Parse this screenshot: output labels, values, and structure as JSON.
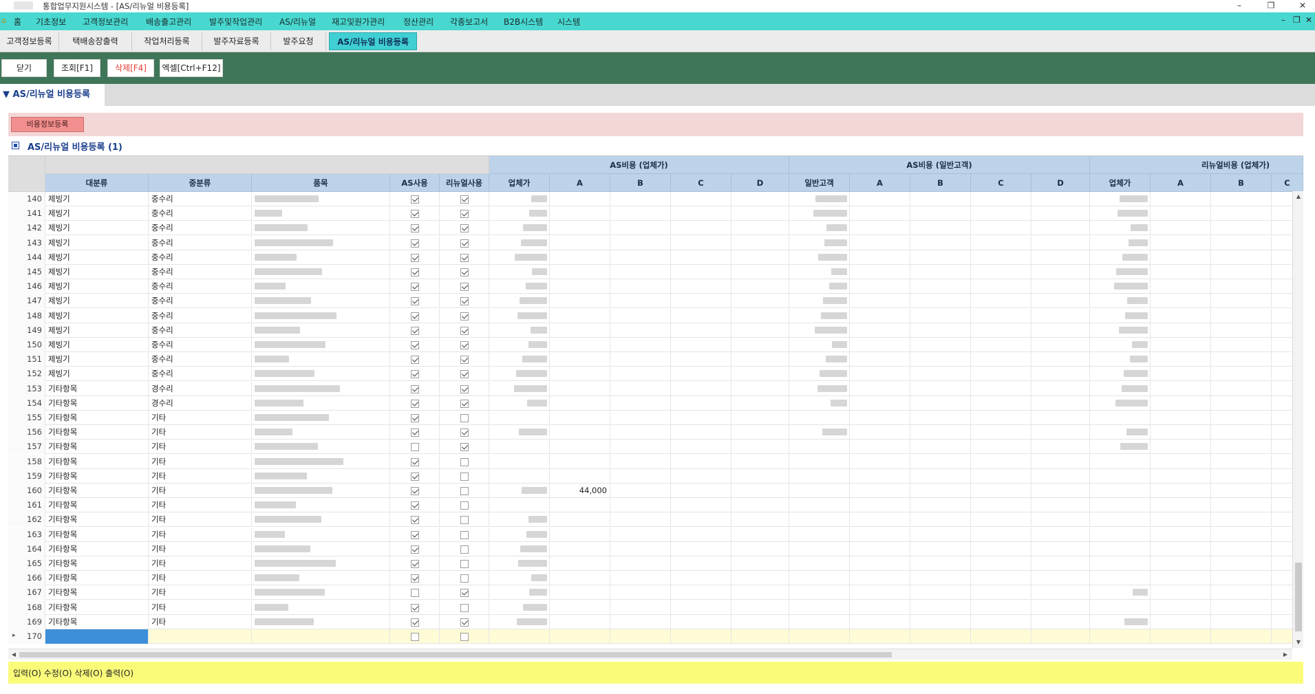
{
  "window": {
    "title": "통합업무지원시스템 - [AS/리뉴얼 비용등록]",
    "controls": [
      "–",
      "❐",
      "✕"
    ]
  },
  "menu": {
    "items": [
      "홈",
      "기초정보",
      "고객정보관리",
      "배송출고관리",
      "발주및작업관리",
      "AS/리뉴얼",
      "재고및원가관리",
      "정산관리",
      "각종보고서",
      "B2B시스템",
      "시스템"
    ],
    "right_controls": [
      "–",
      "❐",
      "✕"
    ]
  },
  "tabs": {
    "items": [
      "고객정보등록",
      "택배송장출력",
      "작업처리등록",
      "발주자료등록",
      "발주요청",
      "AS/리뉴얼 비용등록"
    ],
    "active_index": 5
  },
  "toolbar": {
    "close": "닫기",
    "search": "조회[F1]",
    "delete": "삭제[F4]",
    "excel": "엑셀[Ctrl+F12]"
  },
  "section": {
    "tab_label": "▼ AS/리뉴얼 비용등록"
  },
  "panel": {
    "button": "비용정보등록"
  },
  "grid": {
    "title": "AS/리뉴얼 비용등록 (1)",
    "group_headers": [
      "AS비용 (업체가)",
      "AS비용 (일반고객)",
      "리뉴얼비용 (업체가)"
    ],
    "columns": [
      "대분류",
      "중분류",
      "품목",
      "AS사용",
      "리뉴얼사용",
      "업체가",
      "A",
      "B",
      "C",
      "D",
      "일반고객",
      "A",
      "B",
      "C",
      "D",
      "업체가",
      "A",
      "B",
      "C"
    ],
    "rows": [
      {
        "no": "140",
        "major": "제빙기",
        "minor": "중수리",
        "as": true,
        "renew": true
      },
      {
        "no": "141",
        "major": "제빙기",
        "minor": "중수리",
        "as": true,
        "renew": true
      },
      {
        "no": "142",
        "major": "제빙기",
        "minor": "중수리",
        "as": true,
        "renew": true
      },
      {
        "no": "143",
        "major": "제빙기",
        "minor": "중수리",
        "as": true,
        "renew": true
      },
      {
        "no": "144",
        "major": "제빙기",
        "minor": "중수리",
        "as": true,
        "renew": true
      },
      {
        "no": "145",
        "major": "제빙기",
        "minor": "중수리",
        "as": true,
        "renew": true
      },
      {
        "no": "146",
        "major": "제빙기",
        "minor": "중수리",
        "as": true,
        "renew": true
      },
      {
        "no": "147",
        "major": "제빙기",
        "minor": "중수리",
        "as": true,
        "renew": true
      },
      {
        "no": "148",
        "major": "제빙기",
        "minor": "중수리",
        "as": true,
        "renew": true
      },
      {
        "no": "149",
        "major": "제빙기",
        "minor": "중수리",
        "as": true,
        "renew": true
      },
      {
        "no": "150",
        "major": "제빙기",
        "minor": "중수리",
        "as": true,
        "renew": true
      },
      {
        "no": "151",
        "major": "제빙기",
        "minor": "중수리",
        "as": true,
        "renew": true
      },
      {
        "no": "152",
        "major": "제빙기",
        "minor": "중수리",
        "as": true,
        "renew": true
      },
      {
        "no": "153",
        "major": "기타항목",
        "minor": "경수리",
        "as": true,
        "renew": true
      },
      {
        "no": "154",
        "major": "기타항목",
        "minor": "경수리",
        "as": true,
        "renew": true
      },
      {
        "no": "155",
        "major": "기타항목",
        "minor": "기타",
        "as": true,
        "renew": false
      },
      {
        "no": "156",
        "major": "기타항목",
        "minor": "기타",
        "as": true,
        "renew": true
      },
      {
        "no": "157",
        "major": "기타항목",
        "minor": "기타",
        "as": false,
        "renew": true
      },
      {
        "no": "158",
        "major": "기타항목",
        "minor": "기타",
        "as": true,
        "renew": false
      },
      {
        "no": "159",
        "major": "기타항목",
        "minor": "기타",
        "as": true,
        "renew": false
      },
      {
        "no": "160",
        "major": "기타항목",
        "minor": "기타",
        "as": true,
        "renew": false,
        "as_a": "44,000"
      },
      {
        "no": "161",
        "major": "기타항목",
        "minor": "기타",
        "as": true,
        "renew": false
      },
      {
        "no": "162",
        "major": "기타항목",
        "minor": "기타",
        "as": true,
        "renew": false
      },
      {
        "no": "163",
        "major": "기타항목",
        "minor": "기타",
        "as": true,
        "renew": false
      },
      {
        "no": "164",
        "major": "기타항목",
        "minor": "기타",
        "as": true,
        "renew": false
      },
      {
        "no": "165",
        "major": "기타항목",
        "minor": "기타",
        "as": true,
        "renew": false
      },
      {
        "no": "166",
        "major": "기타항목",
        "minor": "기타",
        "as": true,
        "renew": false
      },
      {
        "no": "167",
        "major": "기타항목",
        "minor": "기타",
        "as": false,
        "renew": true
      },
      {
        "no": "168",
        "major": "기타항목",
        "minor": "기타",
        "as": true,
        "renew": false
      },
      {
        "no": "169",
        "major": "기타항목",
        "minor": "기타",
        "as": true,
        "renew": true
      },
      {
        "no": "170",
        "major": "",
        "minor": "",
        "as": false,
        "renew": false,
        "new": true
      }
    ]
  },
  "status": {
    "text": "입력(O) 수정(O) 삭제(O) 출력(O)"
  },
  "colors": {
    "menubar": "#48d8d0",
    "active_tab": "#40cfd2",
    "toolbar": "#3f7558",
    "header": "#bdd3ea",
    "panel": "#f3d6d6",
    "status": "#fbfb7a",
    "selection": "#3d8fd9"
  }
}
